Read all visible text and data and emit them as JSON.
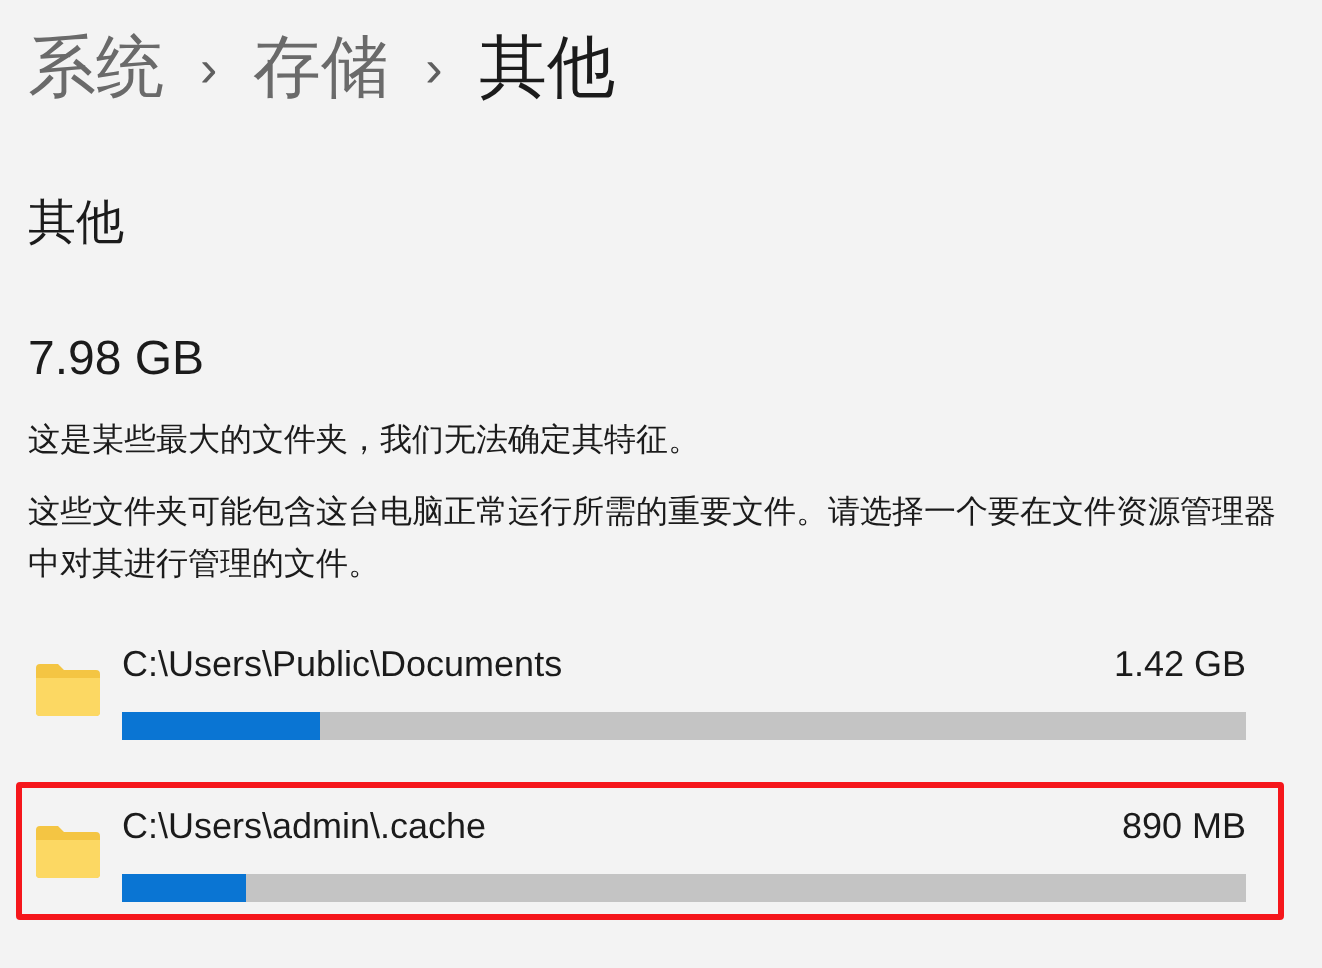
{
  "breadcrumb": [
    {
      "label": "系统",
      "current": false
    },
    {
      "label": "存储",
      "current": false
    },
    {
      "label": "其他",
      "current": true
    }
  ],
  "separator": "›",
  "heading": "其他",
  "total_size": "7.98 GB",
  "descriptions": [
    "这是某些最大的文件夹，我们无法确定其特征。",
    "这些文件夹可能包含这台电脑正常运行所需的重要文件。请选择一个要在文件资源管理器中对其进行管理的文件。"
  ],
  "folders": [
    {
      "path": "C:\\Users\\Public\\Documents",
      "size": "1.42 GB",
      "level": 0.177,
      "highlighted": false
    },
    {
      "path": "C:\\Users\\admin\\.cache",
      "size": "890 MB",
      "level": 0.11,
      "highlighted": true
    }
  ]
}
